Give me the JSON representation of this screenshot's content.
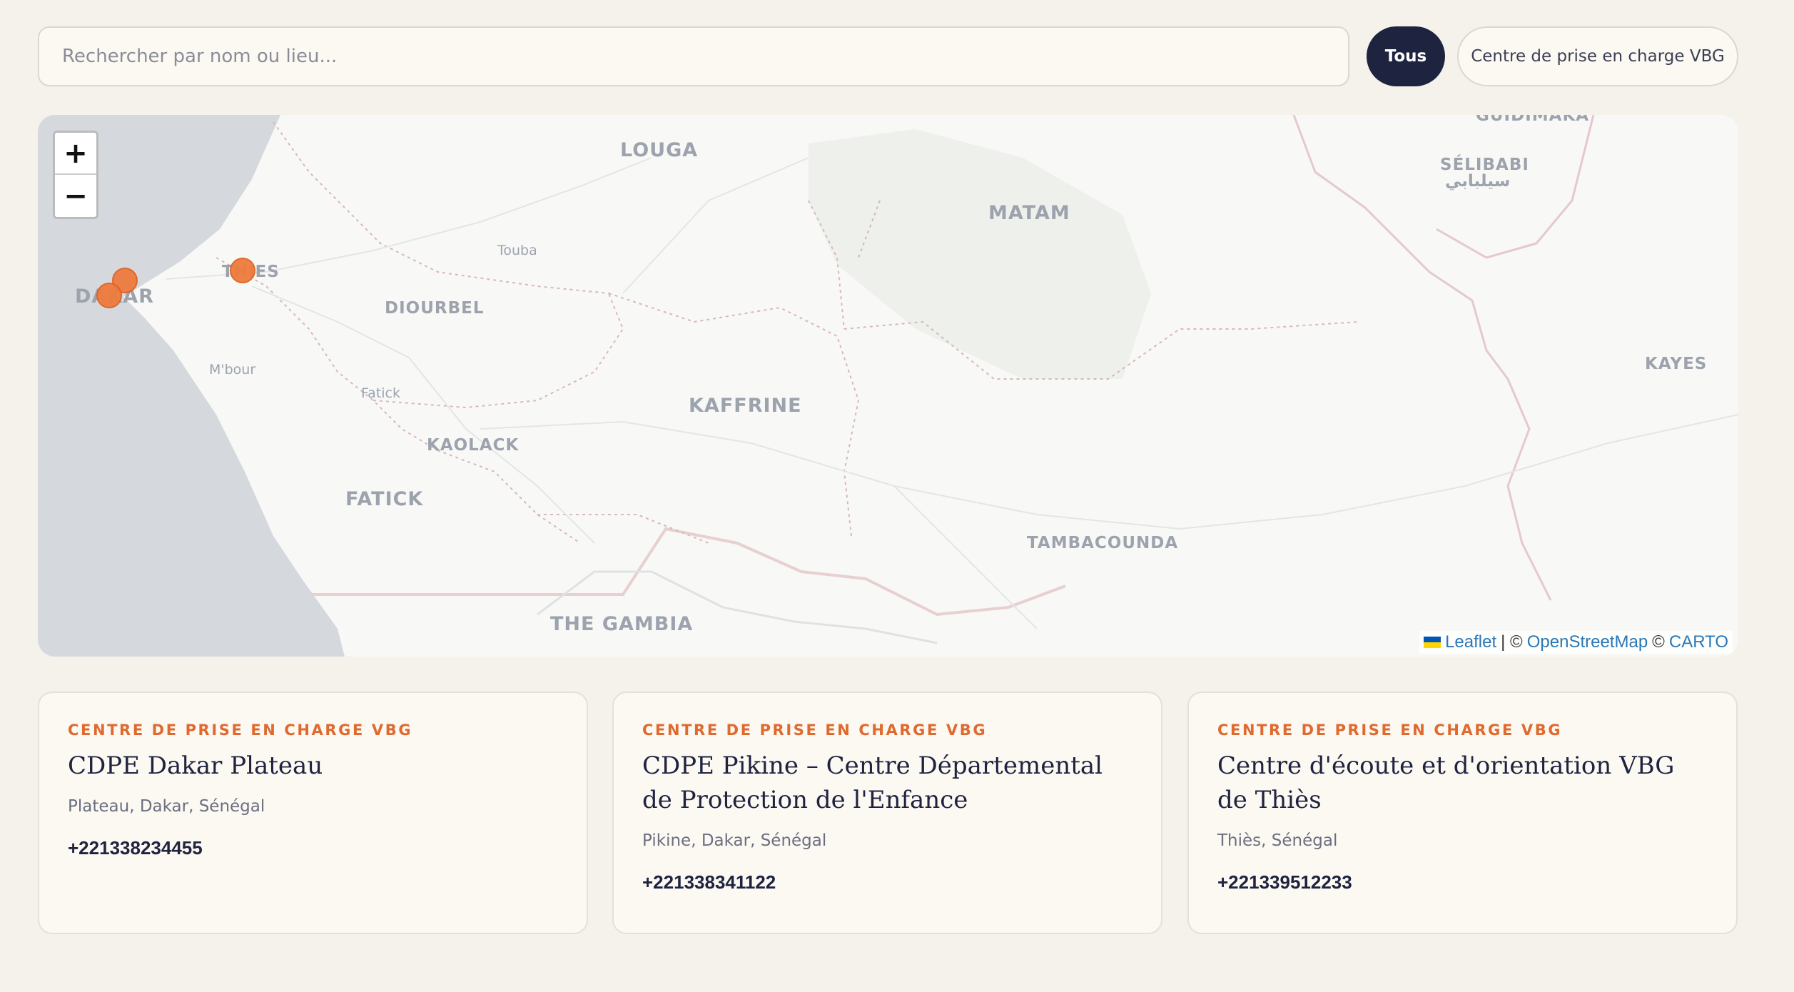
{
  "search": {
    "placeholder": "Rechercher par nom ou lieu..."
  },
  "filters": [
    {
      "label": "Tous",
      "active": true
    },
    {
      "label": "Centre de prise en charge VBG",
      "active": false
    }
  ],
  "map": {
    "zoom_in": "+",
    "zoom_out": "−",
    "places": {
      "louga": "LOUGA",
      "matam": "MATAM",
      "guidimaka": "GUIDIMAKA",
      "selibabi": "SÉLIBABI",
      "selibabi_ar": "سيلبابي",
      "touba": "Touba",
      "thies": "THIES",
      "dakar": "DAKAR",
      "diourbel": "DIOURBEL",
      "mbour": "M'bour",
      "fatick_town": "Fatick",
      "kaffrine": "KAFFRINE",
      "kaolack": "KAOLACK",
      "fatick": "FATICK",
      "kayes": "KAYES",
      "tambacounda": "TAMBACOUNDA",
      "gambia": "THE GAMBIA"
    },
    "attribution": {
      "leaflet": "Leaflet",
      "sep1": "| ©",
      "osm": "OpenStreetMap",
      "sep2": "©",
      "carto": "CARTO"
    }
  },
  "cards": [
    {
      "category": "Centre de prise en charge VBG",
      "title": "CDPE Dakar Plateau",
      "location": "Plateau, Dakar, Sénégal",
      "phone": "+221338234455"
    },
    {
      "category": "Centre de prise en charge VBG",
      "title": "CDPE Pikine – Centre Départemental de Protection de l'Enfance",
      "location": "Pikine, Dakar, Sénégal",
      "phone": "+221338341122"
    },
    {
      "category": "Centre de prise en charge VBG",
      "title": "Centre d'écoute et d'orientation VBG de Thiès",
      "location": "Thiès, Sénégal",
      "phone": "+221339512233"
    }
  ],
  "colors": {
    "accent": "#e0692e",
    "primary": "#1e2340",
    "marker": "#ee7b3d",
    "background": "#f5f1eb"
  }
}
